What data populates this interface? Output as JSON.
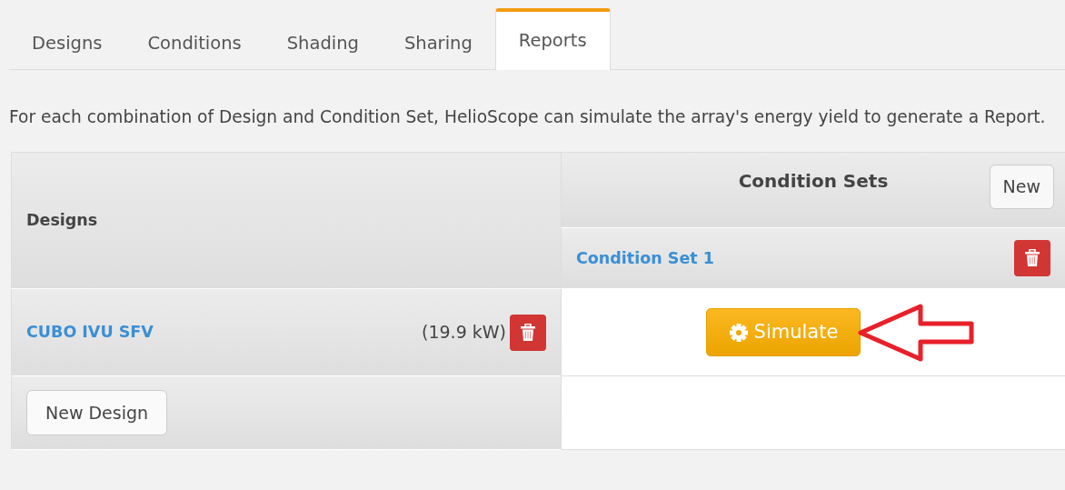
{
  "tabs": [
    {
      "label": "Designs",
      "selected": false
    },
    {
      "label": "Conditions",
      "selected": false
    },
    {
      "label": "Shading",
      "selected": false
    },
    {
      "label": "Sharing",
      "selected": false
    },
    {
      "label": "Reports",
      "selected": true
    }
  ],
  "intro": "For each combination of Design and Condition Set, HelioScope can simulate the array's energy yield to generate a Report.",
  "designs_header": "Designs",
  "condition_sets_header": "Condition Sets",
  "new_condition_set_button": "New",
  "condition_sets": [
    {
      "name": "Condition Set 1"
    }
  ],
  "designs": [
    {
      "name": "CUBO IVU SFV",
      "power": "(19.9 kW)"
    }
  ],
  "simulate_button": "Simulate",
  "new_design_button": "New Design"
}
